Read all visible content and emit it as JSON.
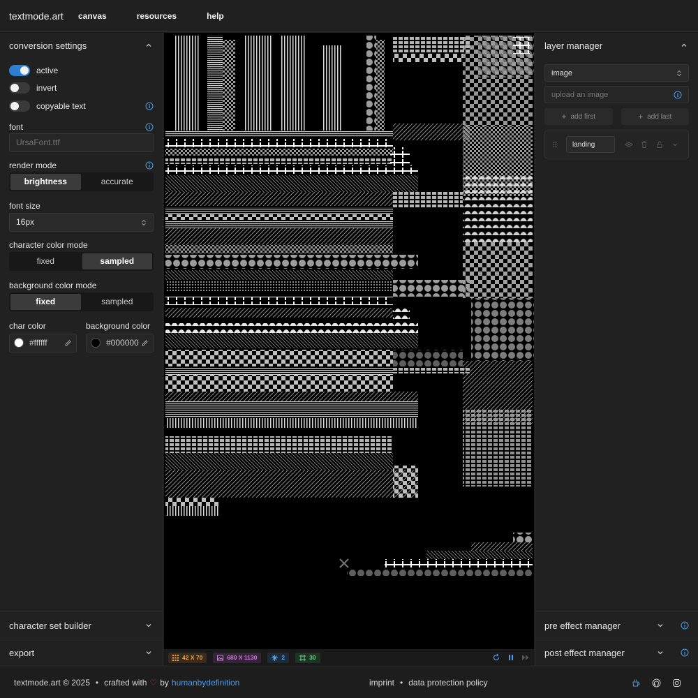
{
  "header": {
    "brand": "textmode.art",
    "menu": [
      "canvas",
      "resources",
      "help"
    ]
  },
  "left_panel": {
    "title": "conversion settings",
    "toggles": [
      {
        "label": "active",
        "on": true
      },
      {
        "label": "invert",
        "on": false
      },
      {
        "label": "copyable text",
        "on": false
      }
    ],
    "font": {
      "label": "font",
      "placeholder": "UrsaFont.ttf"
    },
    "render_mode": {
      "label": "render mode",
      "options": [
        "brightness",
        "accurate"
      ],
      "selected": "brightness"
    },
    "font_size": {
      "label": "font size",
      "value": "16px"
    },
    "char_color_mode": {
      "label": "character color mode",
      "options": [
        "fixed",
        "sampled"
      ],
      "selected": "sampled"
    },
    "bg_color_mode": {
      "label": "background color mode",
      "options": [
        "fixed",
        "sampled"
      ],
      "selected": "fixed"
    },
    "char_color": {
      "label": "char color",
      "value": "#ffffff"
    },
    "bg_color": {
      "label": "background color",
      "value": "#000000"
    },
    "char_set_builder": "character set builder",
    "export": "export"
  },
  "right_panel": {
    "title": "layer manager",
    "layer_type": "image",
    "upload_placeholder": "upload an image",
    "add_first": "add first",
    "add_last": "add last",
    "layer_name": "landing",
    "pre_effect": "pre effect manager",
    "post_effect": "post effect manager"
  },
  "status_bar": {
    "grid": "42 X 70",
    "image_size": "680 X 1130",
    "layers": "2",
    "fps": "30"
  },
  "footer": {
    "copyright": "textmode.art © 2025",
    "sep": "•",
    "crafted": "crafted with",
    "heart": "♡",
    "by": "by",
    "author": "humanbydefinition",
    "imprint": "imprint",
    "privacy": "data protection policy"
  },
  "colors": {
    "accent": "#2d7fd3",
    "link": "#4a9be8",
    "badge_grid": "#f0a04b",
    "badge_image": "#c97ad8",
    "badge_layers": "#5aa6f2",
    "badge_fps": "#6bd08a"
  }
}
